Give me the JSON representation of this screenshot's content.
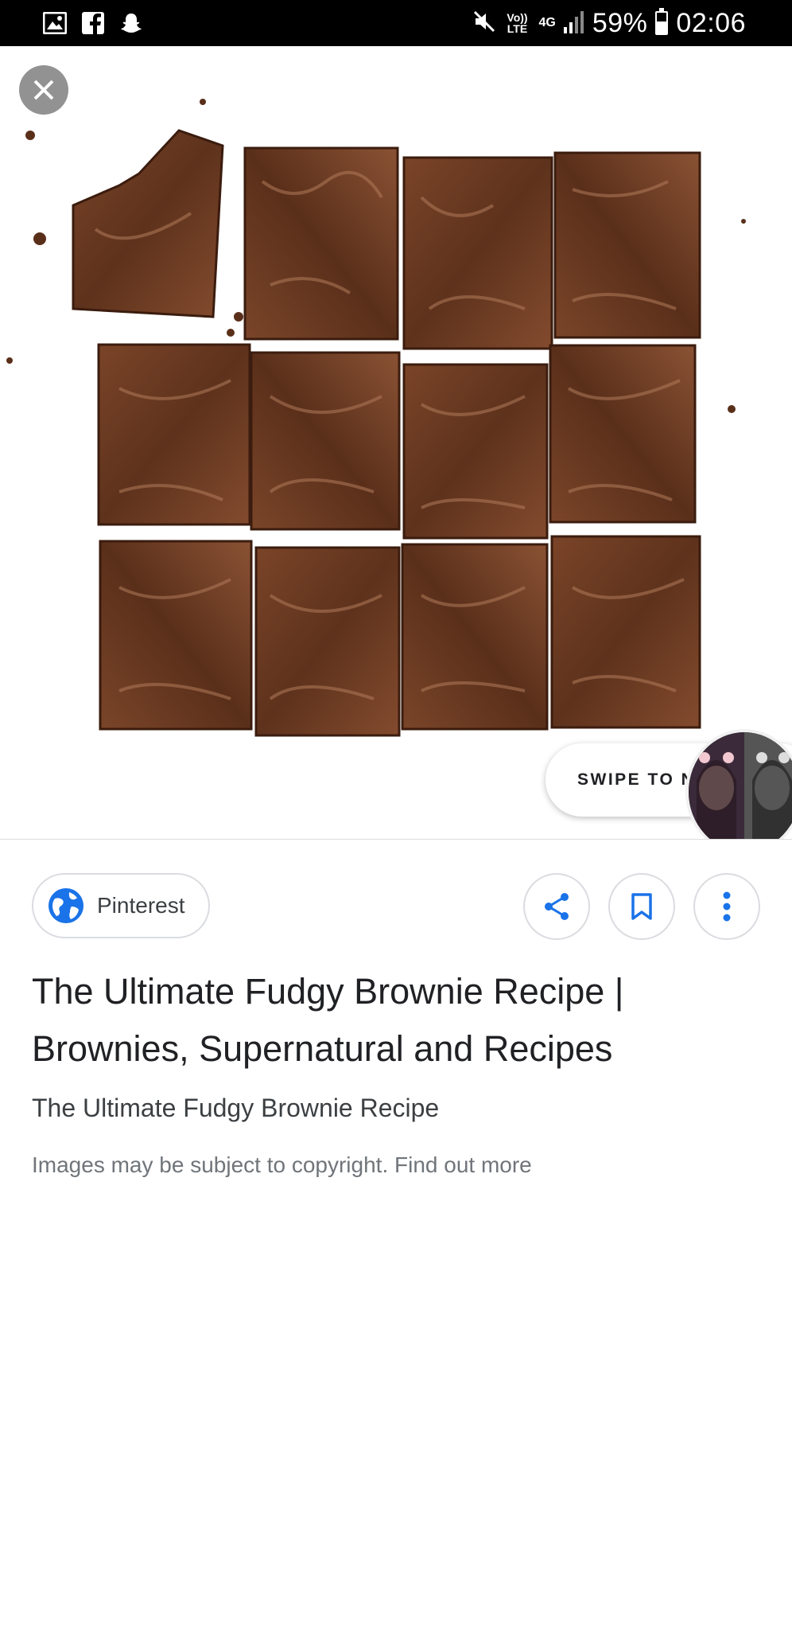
{
  "status_bar": {
    "left_icons": [
      "image-icon",
      "facebook-icon",
      "snapchat-icon"
    ],
    "volte": "Vo)) LTE",
    "network": "4G",
    "battery": "59%",
    "battery_level": 0.59,
    "time": "02:06"
  },
  "viewer": {
    "close_icon": "close-icon",
    "swipe_label": "SWIPE TO N"
  },
  "source": {
    "icon": "globe-icon",
    "label": "Pinterest"
  },
  "actions": [
    "share-icon",
    "bookmark-icon",
    "more-vert-icon"
  ],
  "result": {
    "title": "The Ultimate Fudgy Brownie Recipe | Brownies, Supernatural and Recipes",
    "subtitle": "The Ultimate Fudgy Brownie Recipe",
    "copyright": "Images may be subject to copyright. Find out more"
  },
  "colors": {
    "accent": "#1a73e8",
    "brownie": "#6b3a22"
  }
}
